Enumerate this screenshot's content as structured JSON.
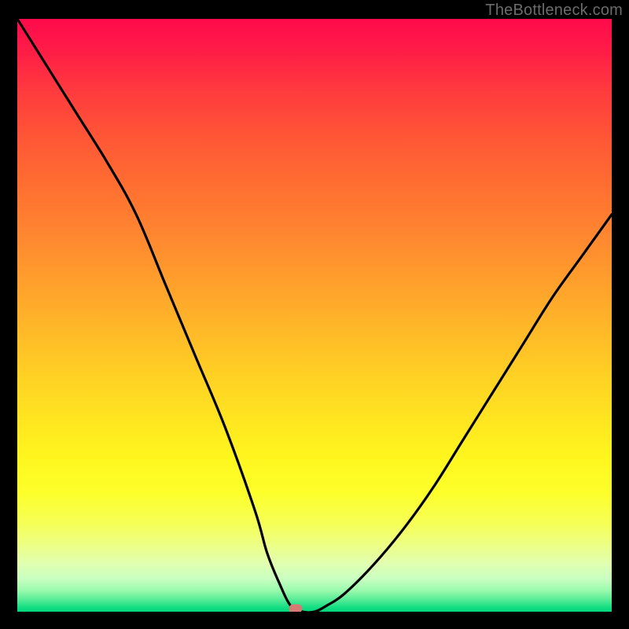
{
  "watermark": "TheBottleneck.com",
  "chart_data": {
    "type": "line",
    "title": "",
    "xlabel": "",
    "ylabel": "",
    "xlim": [
      0,
      100
    ],
    "ylim": [
      0,
      100
    ],
    "grid": false,
    "legend": false,
    "marker": {
      "x": 46.8,
      "y": 0
    },
    "series": [
      {
        "name": "bottleneck-curve",
        "x": [
          0,
          5,
          10,
          15,
          20,
          25,
          30,
          35,
          40,
          42,
          44,
          46,
          48,
          50,
          52,
          55,
          60,
          65,
          70,
          75,
          80,
          85,
          90,
          95,
          100
        ],
        "values": [
          100,
          92,
          84,
          76,
          67,
          55,
          43,
          31,
          17,
          10,
          5,
          1,
          0,
          0,
          1,
          3,
          8,
          14,
          21,
          29,
          37,
          45,
          53,
          60,
          67
        ]
      }
    ],
    "background_gradient": {
      "top": "#ff0a4c",
      "upper_mid": "#ff8530",
      "mid": "#ffe620",
      "lower_mid": "#ecff89",
      "bottom": "#00d77b"
    }
  }
}
